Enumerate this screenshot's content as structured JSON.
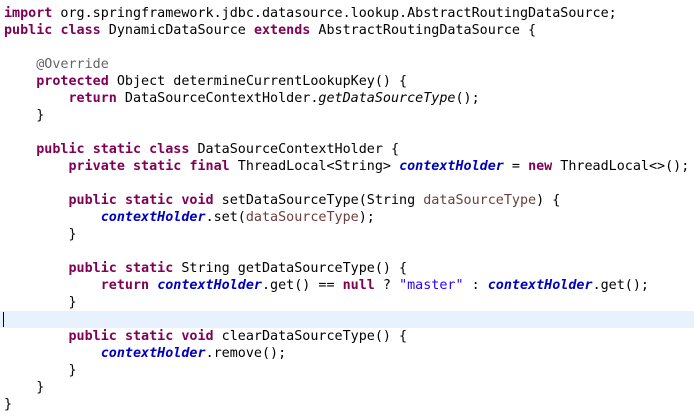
{
  "editor": {
    "lines": [
      [
        {
          "t": "import",
          "c": "kw"
        },
        {
          "t": " org.springframework.jdbc.datasource.lookup.AbstractRoutingDataSource;"
        }
      ],
      [
        {
          "t": "public",
          "c": "kw"
        },
        {
          "t": " "
        },
        {
          "t": "class",
          "c": "kw"
        },
        {
          "t": " DynamicDataSource "
        },
        {
          "t": "extends",
          "c": "kw"
        },
        {
          "t": " AbstractRoutingDataSource {"
        }
      ],
      [],
      [
        {
          "t": "    "
        },
        {
          "t": "@Override",
          "c": "ann"
        }
      ],
      [
        {
          "t": "    "
        },
        {
          "t": "protected",
          "c": "kw"
        },
        {
          "t": " Object determineCurrentLookupKey() {"
        }
      ],
      [
        {
          "t": "        "
        },
        {
          "t": "return",
          "c": "kw"
        },
        {
          "t": " DataSourceContextHolder."
        },
        {
          "t": "getDataSourceType",
          "c": "im"
        },
        {
          "t": "();"
        }
      ],
      [
        {
          "t": "    }"
        }
      ],
      [],
      [
        {
          "t": "    "
        },
        {
          "t": "public",
          "c": "kw"
        },
        {
          "t": " "
        },
        {
          "t": "static",
          "c": "kw"
        },
        {
          "t": " "
        },
        {
          "t": "class",
          "c": "kw"
        },
        {
          "t": " DataSourceContextHolder {"
        }
      ],
      [
        {
          "t": "        "
        },
        {
          "t": "private",
          "c": "kw"
        },
        {
          "t": " "
        },
        {
          "t": "static",
          "c": "kw"
        },
        {
          "t": " "
        },
        {
          "t": "final",
          "c": "kw"
        },
        {
          "t": " ThreadLocal<String> "
        },
        {
          "t": "contextHolder",
          "c": "field"
        },
        {
          "t": " = "
        },
        {
          "t": "new",
          "c": "kw"
        },
        {
          "t": " ThreadLocal<>();"
        }
      ],
      [],
      [
        {
          "t": "        "
        },
        {
          "t": "public",
          "c": "kw"
        },
        {
          "t": " "
        },
        {
          "t": "static",
          "c": "kw"
        },
        {
          "t": " "
        },
        {
          "t": "void",
          "c": "kw"
        },
        {
          "t": " setDataSourceType(String "
        },
        {
          "t": "dataSourceType",
          "c": "param"
        },
        {
          "t": ") {"
        }
      ],
      [
        {
          "t": "            "
        },
        {
          "t": "contextHolder",
          "c": "field"
        },
        {
          "t": ".set("
        },
        {
          "t": "dataSourceType",
          "c": "param"
        },
        {
          "t": ");"
        }
      ],
      [
        {
          "t": "        }"
        }
      ],
      [],
      [
        {
          "t": "        "
        },
        {
          "t": "public",
          "c": "kw"
        },
        {
          "t": " "
        },
        {
          "t": "static",
          "c": "kw"
        },
        {
          "t": " String getDataSourceType() {"
        }
      ],
      [
        {
          "t": "            "
        },
        {
          "t": "return",
          "c": "kw"
        },
        {
          "t": " "
        },
        {
          "t": "contextHolder",
          "c": "field"
        },
        {
          "t": ".get() == "
        },
        {
          "t": "null",
          "c": "kw"
        },
        {
          "t": " ? "
        },
        {
          "t": "\"master\"",
          "c": "str"
        },
        {
          "t": " : "
        },
        {
          "t": "contextHolder",
          "c": "field"
        },
        {
          "t": ".get();"
        }
      ],
      [
        {
          "t": "        }"
        }
      ],
      [],
      [
        {
          "t": "        "
        },
        {
          "t": "public",
          "c": "kw"
        },
        {
          "t": " "
        },
        {
          "t": "static",
          "c": "kw"
        },
        {
          "t": " "
        },
        {
          "t": "void",
          "c": "kw"
        },
        {
          "t": " clearDataSourceType() {"
        }
      ],
      [
        {
          "t": "            "
        },
        {
          "t": "contextHolder",
          "c": "field"
        },
        {
          "t": ".remove();"
        }
      ],
      [
        {
          "t": "        }"
        }
      ],
      [
        {
          "t": "    }"
        }
      ],
      [
        {
          "t": "}"
        }
      ]
    ],
    "current_line": 18
  }
}
